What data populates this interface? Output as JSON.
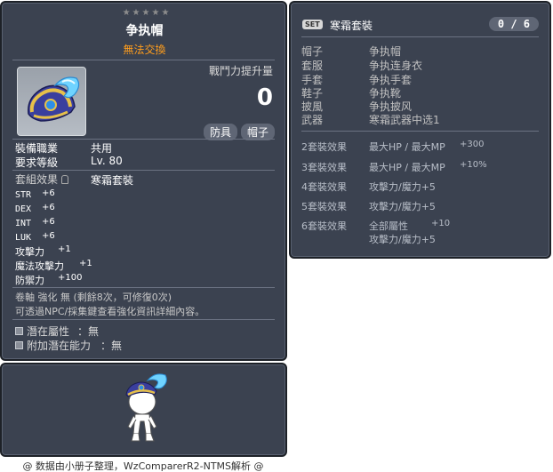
{
  "item_id": "01003741",
  "item": {
    "name": "争执帽",
    "tradability": "無法交換",
    "combat_power_label": "戰鬥力提升量",
    "combat_power_value": "0",
    "tags": [
      "防具",
      "帽子"
    ],
    "requirements": [
      {
        "label": "裝備職業",
        "value": "共用"
      },
      {
        "label": "要求等級",
        "value": "Lv. 80"
      }
    ],
    "set_effect_label": "套組效果",
    "set_effect_name": "寒霜套裝",
    "stats": [
      {
        "label": "STR",
        "value": "+6"
      },
      {
        "label": "DEX",
        "value": "+6"
      },
      {
        "label": "INT",
        "value": "+6"
      },
      {
        "label": "LUK",
        "value": "+6"
      },
      {
        "label": "攻擊力",
        "value": "+1"
      },
      {
        "label": "魔法攻擊力",
        "value": "+1"
      },
      {
        "label": "防禦力",
        "value": "+100"
      }
    ],
    "scroll_text": "卷軸 強化 無 (剩餘8次，可修復0次)",
    "info_text": "可透過NPC/採集鍵查看強化資訊詳細內容。",
    "potential": [
      {
        "label": "潛在屬性",
        "value": "：無"
      },
      {
        "label": "附加潛在能力",
        "value": "：無"
      }
    ]
  },
  "set": {
    "badge": "SET",
    "name": "寒霜套裝",
    "count": "0 / 6",
    "parts": [
      {
        "slot": "帽子",
        "name": "争执帽"
      },
      {
        "slot": "套服",
        "name": "争执连身衣"
      },
      {
        "slot": "手套",
        "name": "争执手套"
      },
      {
        "slot": "鞋子",
        "name": "争执靴"
      },
      {
        "slot": "披風",
        "name": "争执披风"
      },
      {
        "slot": "武器",
        "name": "寒霜武器中选1"
      }
    ],
    "effects": [
      {
        "tier": "2套裝效果",
        "lines": [
          {
            "text": "最大HP / 最大MP",
            "num": "+300"
          }
        ]
      },
      {
        "tier": "3套裝效果",
        "lines": [
          {
            "text": "最大HP / 最大MP",
            "num": "+10%"
          }
        ]
      },
      {
        "tier": "4套裝效果",
        "lines": [
          {
            "text": "攻擊力/魔力+5",
            "num": ""
          }
        ]
      },
      {
        "tier": "5套裝效果",
        "lines": [
          {
            "text": "攻擊力/魔力+5",
            "num": ""
          }
        ]
      },
      {
        "tier": "6套裝效果",
        "lines": [
          {
            "text": "全部屬性",
            "num": "+10"
          },
          {
            "text": "攻擊力/魔力+5",
            "num": ""
          }
        ]
      }
    ]
  },
  "credit": "@ 数据由小册子整理，WzComparerR2-NTMS解析 @",
  "colors": {
    "panel_bg": "#3b4250",
    "untradeable": "#ff9d1c",
    "tag_bg": "#5f6675"
  }
}
